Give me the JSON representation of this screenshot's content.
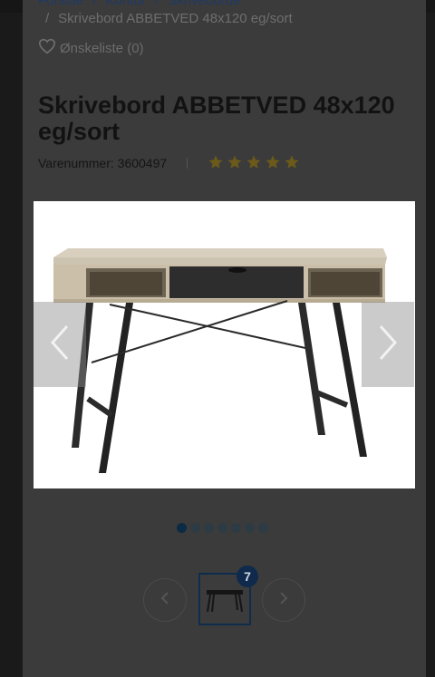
{
  "breadcrumb": {
    "items": [
      "Forside",
      "Kontor",
      "Skriveborde"
    ],
    "separator": "/",
    "current": "Skrivebord ABBETVED 48x120 eg/sort"
  },
  "wishlist": {
    "label": "Ønskeliste (0)"
  },
  "product": {
    "title": "Skrivebord ABBETVED 48x120 eg/sort",
    "sku_label": "Varenummer: 3600497",
    "rating": 5,
    "max_rating": 5
  },
  "gallery": {
    "total_images": 7,
    "current_index": 0,
    "thumbnail_badge": "7"
  },
  "colors": {
    "star": "#6b5a1a",
    "link": "#1e3a66",
    "badge": "#0f2a4c"
  }
}
